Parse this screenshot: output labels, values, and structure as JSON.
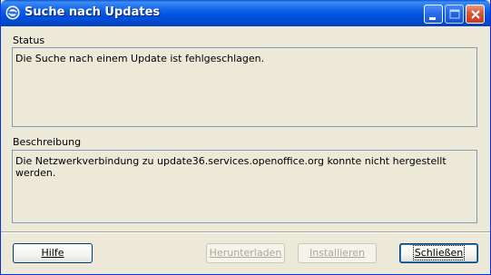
{
  "window": {
    "title": "Suche nach Updates",
    "icon": "openoffice-update-icon"
  },
  "titlebar_buttons": {
    "minimize": "minimize-icon",
    "maximize": "maximize-icon",
    "close": "close-icon"
  },
  "status": {
    "label": "Status",
    "text": "Die Suche nach einem Update ist fehlgeschlagen."
  },
  "description": {
    "label": "Beschreibung",
    "text": "Die Netzwerkverbindung zu update36.services.openoffice.org konnte nicht hergestellt werden."
  },
  "buttons": {
    "help": "Hilfe",
    "download": "Herunterladen",
    "install": "Installieren",
    "close": "Schließen"
  }
}
